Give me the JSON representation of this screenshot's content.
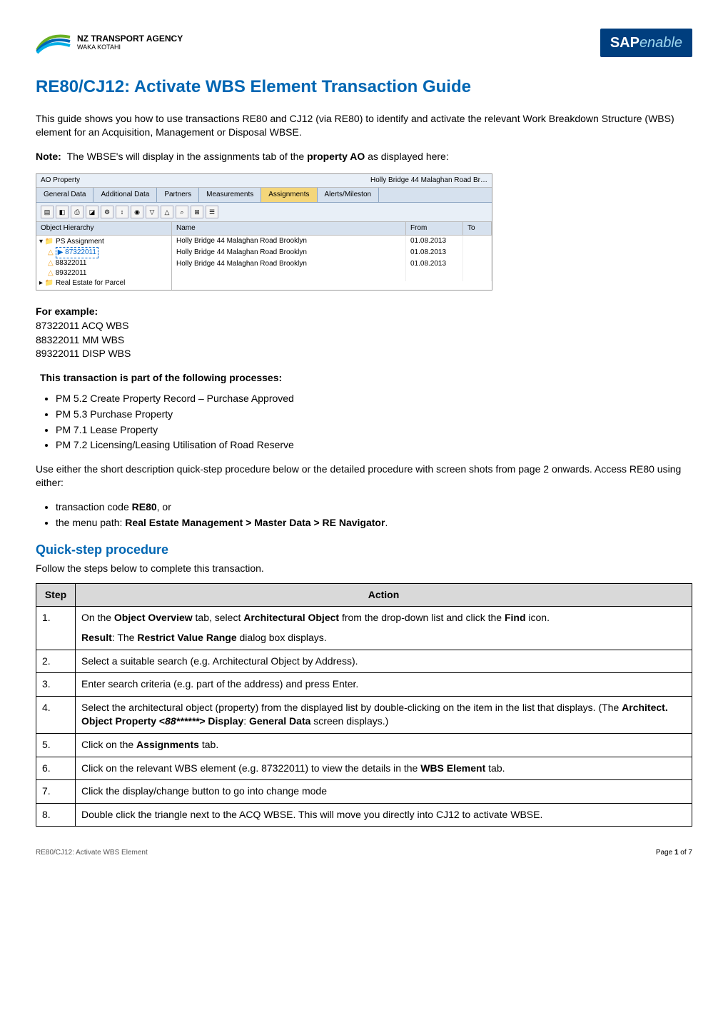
{
  "header": {
    "leftLogoLine1": "NZ TRANSPORT AGENCY",
    "leftLogoLine2": "WAKA KOTAHI",
    "rightLogoSAP": "SAP",
    "rightLogoEnable": "enable"
  },
  "title": "RE80/CJ12: Activate WBS Element Transaction Guide",
  "intro": "This guide shows you how to use transactions RE80 and CJ12 (via RE80) to identify and activate the relevant Work Breakdown Structure (WBS) element for an Acquisition, Management or Disposal WBSE.",
  "noteLabel": "Note:",
  "noteText": "The WBSE's will display in the assignments tab of the ",
  "noteBold": "property AO",
  "noteTrailing": " as displayed here:",
  "screenshot": {
    "topLeft": "AO Property",
    "topRightPartial": "Holly Bridge 44 Malaghan Road Br…",
    "tabs": [
      "General Data",
      "Additional Data",
      "Partners",
      "Measurements",
      "Assignments",
      "Alerts/Mileston"
    ],
    "activeTab": 4,
    "columns": [
      "Object Hierarchy",
      "Name",
      "From",
      "To"
    ],
    "tree": {
      "root": "PS Assignment",
      "items": [
        {
          "id": "87322011",
          "name": "Holly Bridge 44 Malaghan Road Brooklyn",
          "from": "01.08.2013",
          "highlighted": true
        },
        {
          "id": "88322011",
          "name": "Holly Bridge 44 Malaghan Road Brooklyn",
          "from": "01.08.2013"
        },
        {
          "id": "89322011",
          "name": "Holly Bridge 44 Malaghan Road Brooklyn",
          "from": "01.08.2013"
        }
      ],
      "footerItem": "Real Estate for Parcel"
    }
  },
  "examplesLabel": "For example:",
  "examples": [
    "87322011 ACQ WBS",
    "88322011 MM WBS",
    "89322011 DISP WBS"
  ],
  "processesTitle": "This transaction is part of the following processes:",
  "processes": [
    "PM 5.2 Create Property Record – Purchase Approved",
    "PM 5.3 Purchase Property",
    "PM 7.1 Lease Property",
    "PM 7.2 Licensing/Leasing Utilisation of Road Reserve"
  ],
  "accessIntro": "Use either the short description quick-step procedure below or the detailed procedure with screen shots from page 2 onwards. Access RE80 using either:",
  "accessBullets": [
    {
      "pre": "transaction code ",
      "bold": "RE80",
      "post": ", or"
    },
    {
      "pre": "the menu path: ",
      "bold": "Real Estate Management > Master Data > RE Navigator",
      "post": "."
    }
  ],
  "quickStepTitle": "Quick-step procedure",
  "quickStepIntro": "Follow the steps below to complete this transaction.",
  "tableHeaders": {
    "step": "Step",
    "action": "Action"
  },
  "steps": [
    {
      "n": "1.",
      "html": "On the <b>Object Overview</b> tab, select <b>Architectural Object</b> from the drop-down list and click the <b>Find</b> icon.",
      "resultLabel": "Result",
      "result": ": The <b>Restrict Value Range</b> dialog box displays."
    },
    {
      "n": "2.",
      "html": "Select a suitable search (e.g. Architectural Object by Address)."
    },
    {
      "n": "3.",
      "html": "Enter search criteria (e.g. part of the address) and press Enter."
    },
    {
      "n": "4.",
      "html": "Select  the architectural object (property) from the displayed list by double-clicking on the item in the list that displays. (The <b>Architect. Object Property &lt;<i>88******</i>&gt; Display</b>: <b>General Data</b> screen displays.)"
    },
    {
      "n": "5.",
      "html": "Click on the <b>Assignments</b> tab."
    },
    {
      "n": "6.",
      "html": "Click on the relevant WBS element (e.g. 87322011) to view the details in the <b>WBS Element</b> tab."
    },
    {
      "n": "7.",
      "html": "Click the display/change button to go into change mode"
    },
    {
      "n": "8.",
      "html": "Double click the triangle next to the ACQ WBSE. This will move you directly into CJ12 to activate WBSE."
    }
  ],
  "footer": {
    "left": "RE80/CJ12: Activate WBS Element",
    "rightPrefix": "Page ",
    "pageNum": "1",
    "rightSuffix": " of 7"
  }
}
